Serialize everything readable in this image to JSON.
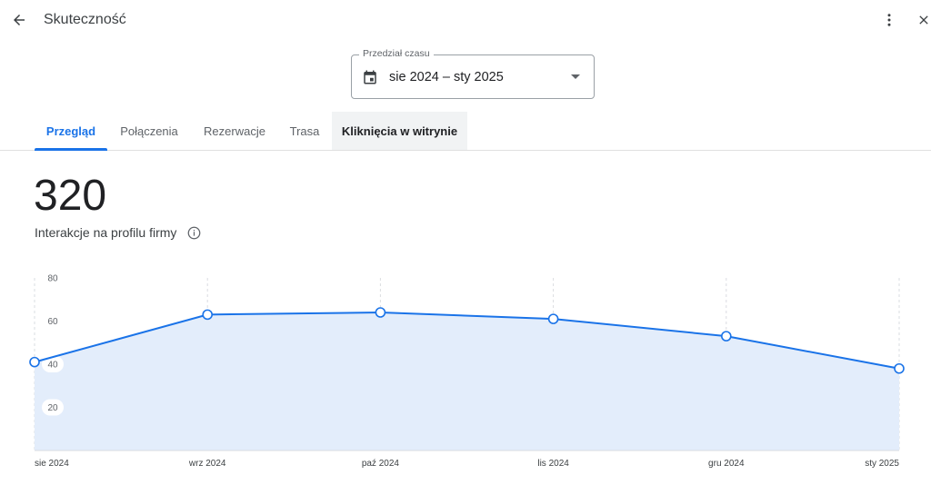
{
  "header": {
    "title": "Skuteczność",
    "back_icon": "arrow-back-icon",
    "more_icon": "more-vert-icon",
    "close_icon": "close-icon"
  },
  "date_range": {
    "legend": "Przedział czasu",
    "value": "sie 2024 – sty 2025",
    "icon": "calendar-icon"
  },
  "tabs": [
    {
      "label": "Przegląd",
      "state": "active"
    },
    {
      "label": "Połączenia",
      "state": "normal"
    },
    {
      "label": "Rezerwacje",
      "state": "normal"
    },
    {
      "label": "Trasa",
      "state": "normal"
    },
    {
      "label": "Kliknięcia w witrynie",
      "state": "hover"
    }
  ],
  "metric": {
    "value": "320",
    "label": "Interakcje na profilu firmy",
    "info_icon": "info-icon"
  },
  "colors": {
    "accent": "#1a73e8",
    "area_fill": "#e3edfb"
  },
  "chart_data": {
    "type": "area",
    "categories": [
      "sie 2024",
      "wrz 2024",
      "paź 2024",
      "lis 2024",
      "gru 2024",
      "sty 2025"
    ],
    "series": [
      {
        "values": [
          41,
          63,
          64,
          61,
          53,
          38
        ]
      }
    ],
    "yticks": [
      20,
      40,
      60,
      80
    ],
    "ylim": [
      0,
      80
    ],
    "grid": "vertical-dashed"
  }
}
